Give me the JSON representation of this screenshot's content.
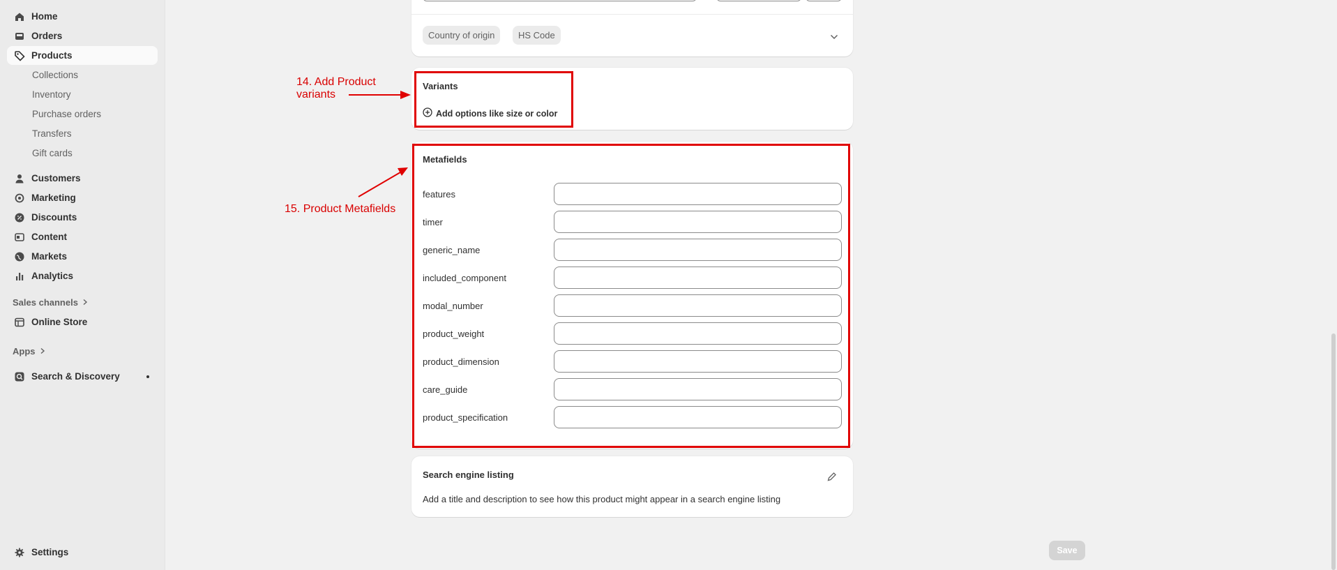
{
  "sidebar": {
    "home": "Home",
    "orders": "Orders",
    "products": "Products",
    "product_sub": [
      "Collections",
      "Inventory",
      "Purchase orders",
      "Transfers",
      "Gift cards"
    ],
    "customers": "Customers",
    "marketing": "Marketing",
    "discounts": "Discounts",
    "content": "Content",
    "markets": "Markets",
    "analytics": "Analytics",
    "sales_channels": "Sales channels",
    "online_store": "Online Store",
    "apps": "Apps",
    "search_discovery": "Search & Discovery",
    "settings": "Settings"
  },
  "customs": {
    "tags": [
      "Country of origin",
      "HS Code"
    ]
  },
  "variants": {
    "title": "Variants",
    "add_options": "Add options like size or color"
  },
  "metafields": {
    "title": "Metafields",
    "fields": [
      "features",
      "timer",
      "generic_name",
      "included_component",
      "modal_number",
      "product_weight",
      "product_dimension",
      "care_guide",
      "product_specification"
    ]
  },
  "seo": {
    "title": "Search engine listing",
    "description": "Add a title and description to see how this product might appear in a search engine listing"
  },
  "annotations": {
    "step14": [
      "14. Add Product",
      "variants"
    ],
    "step15": "15. Product Metafields"
  },
  "actions": {
    "save": "Save"
  },
  "colors": {
    "annotation": "#e00000",
    "sidebar_bg": "#ebebeb",
    "page_bg": "#f1f1f1"
  }
}
